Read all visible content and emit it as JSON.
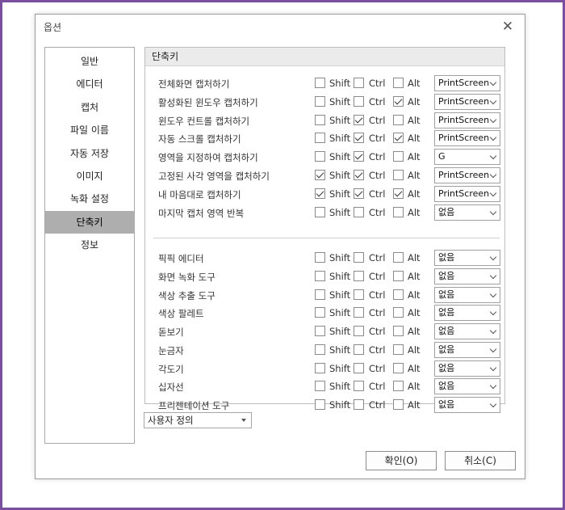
{
  "window": {
    "title": "옵션"
  },
  "sidebar": {
    "items": [
      {
        "label": "일반",
        "selected": false
      },
      {
        "label": "에디터",
        "selected": false
      },
      {
        "label": "캡처",
        "selected": false
      },
      {
        "label": "파일 이름",
        "selected": false
      },
      {
        "label": "자동 저장",
        "selected": false
      },
      {
        "label": "이미지",
        "selected": false
      },
      {
        "label": "녹화 설정",
        "selected": false
      },
      {
        "label": "단축키",
        "selected": true
      },
      {
        "label": "정보",
        "selected": false
      }
    ]
  },
  "panel": {
    "header": "단축키",
    "modifier_labels": {
      "shift": "Shift",
      "ctrl": "Ctrl",
      "alt": "Alt"
    },
    "capture_rows": [
      {
        "label": "전체화면 캡처하기",
        "shift": false,
        "ctrl": false,
        "alt": false,
        "key": "PrintScreen"
      },
      {
        "label": "활성화된 윈도우 캡처하기",
        "shift": false,
        "ctrl": false,
        "alt": true,
        "key": "PrintScreen"
      },
      {
        "label": "윈도우 컨트롤 캡처하기",
        "shift": false,
        "ctrl": true,
        "alt": false,
        "key": "PrintScreen"
      },
      {
        "label": "자동 스크롤 캡처하기",
        "shift": false,
        "ctrl": true,
        "alt": true,
        "key": "PrintScreen"
      },
      {
        "label": "영역을 지정하여 캡처하기",
        "shift": false,
        "ctrl": true,
        "alt": false,
        "key": "G"
      },
      {
        "label": "고정된 사각 영역을 캡처하기",
        "shift": true,
        "ctrl": true,
        "alt": false,
        "key": "PrintScreen"
      },
      {
        "label": "내 마음대로 캡처하기",
        "shift": true,
        "ctrl": true,
        "alt": true,
        "key": "PrintScreen"
      },
      {
        "label": "마지막 캡처 영역 반복",
        "shift": false,
        "ctrl": false,
        "alt": false,
        "key": "없음"
      }
    ],
    "tool_rows": [
      {
        "label": "픽픽 에디터",
        "shift": false,
        "ctrl": false,
        "alt": false,
        "key": "없음"
      },
      {
        "label": "화면 녹화 도구",
        "shift": false,
        "ctrl": false,
        "alt": false,
        "key": "없음"
      },
      {
        "label": "색상 추출 도구",
        "shift": false,
        "ctrl": false,
        "alt": false,
        "key": "없음"
      },
      {
        "label": "색상 팔레트",
        "shift": false,
        "ctrl": false,
        "alt": false,
        "key": "없음"
      },
      {
        "label": "돋보기",
        "shift": false,
        "ctrl": false,
        "alt": false,
        "key": "없음"
      },
      {
        "label": "눈금자",
        "shift": false,
        "ctrl": false,
        "alt": false,
        "key": "없음"
      },
      {
        "label": "각도기",
        "shift": false,
        "ctrl": false,
        "alt": false,
        "key": "없음"
      },
      {
        "label": "십자선",
        "shift": false,
        "ctrl": false,
        "alt": false,
        "key": "없음"
      },
      {
        "label": "프리젠테이션 도구",
        "shift": false,
        "ctrl": false,
        "alt": false,
        "key": "없음"
      }
    ]
  },
  "profile": {
    "value": "사용자 정의"
  },
  "buttons": {
    "ok": "확인(O)",
    "cancel": "취소(C)"
  },
  "colors": {
    "frame": "#7b4fa0",
    "selected_bg": "#aeaeae"
  }
}
